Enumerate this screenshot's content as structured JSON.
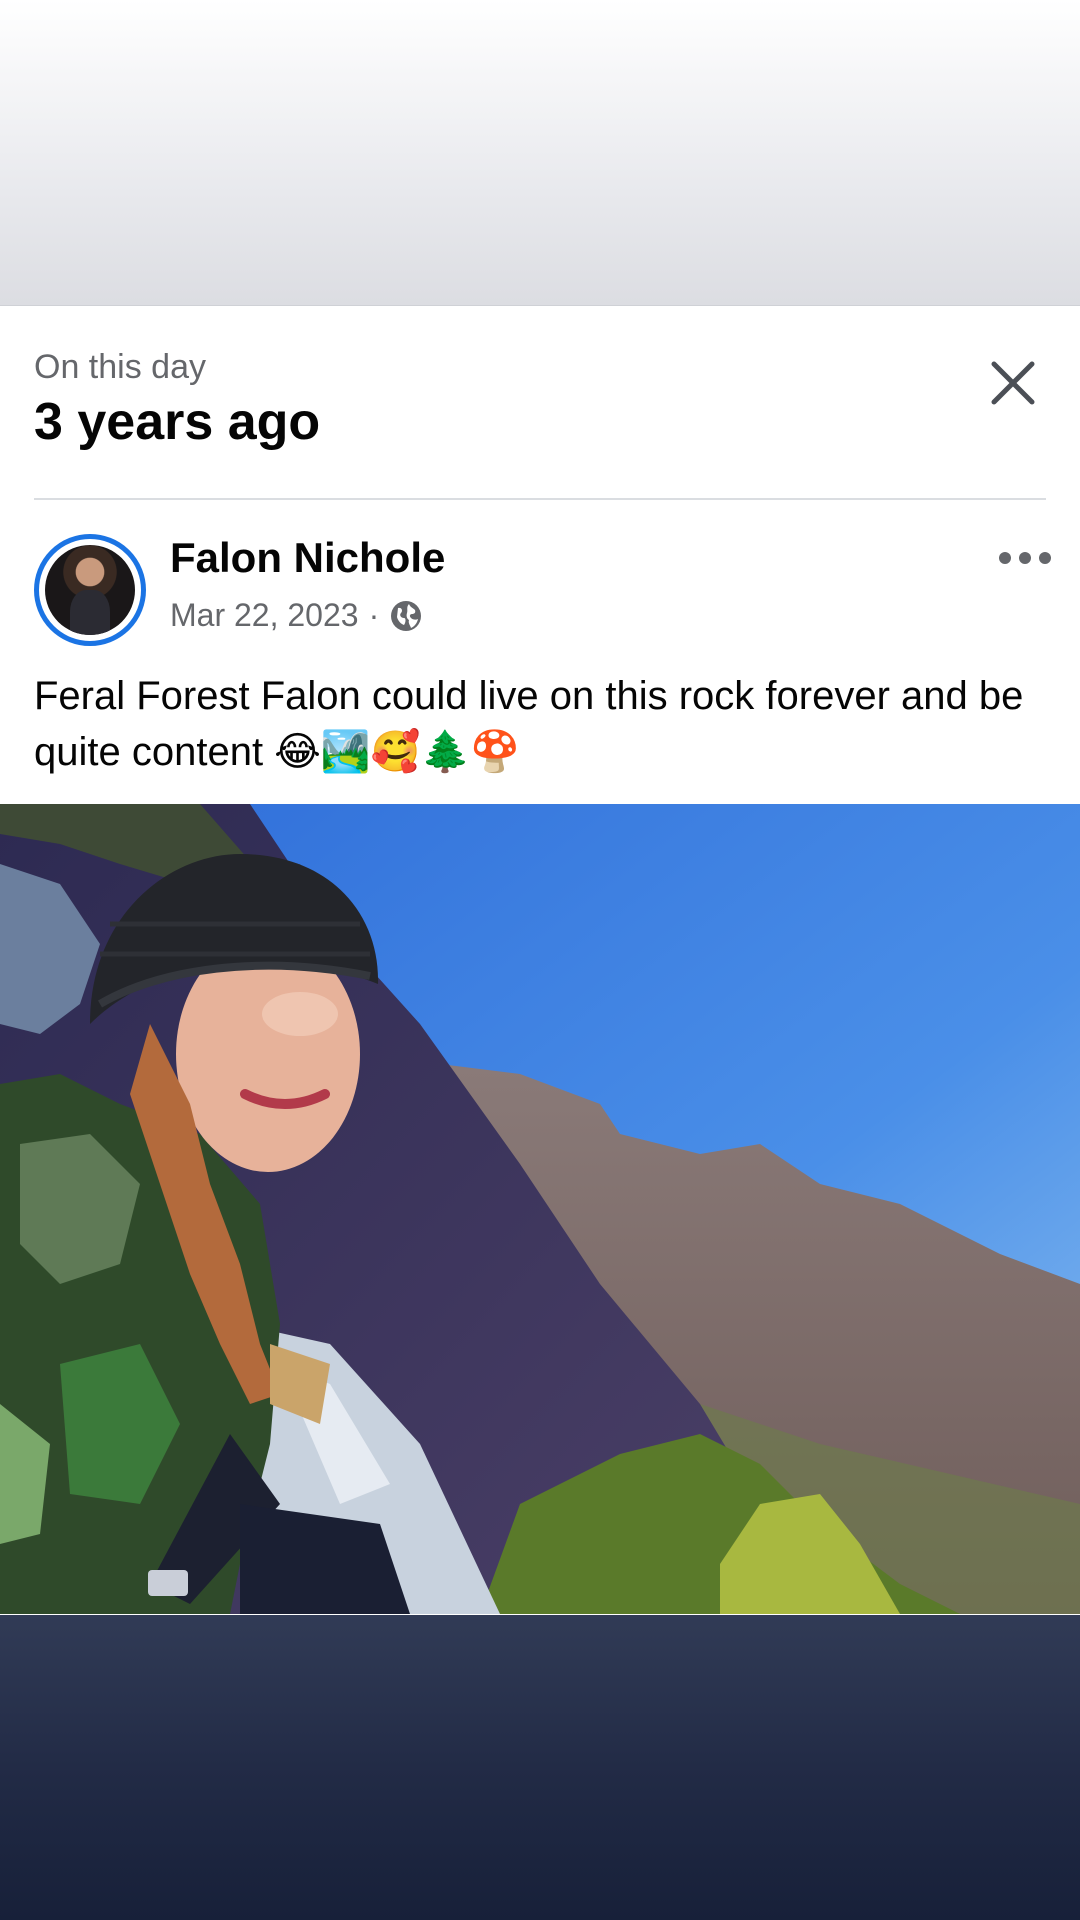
{
  "memory": {
    "eyebrow": "On this day",
    "title": "3 years ago"
  },
  "post": {
    "author": "Falon Nichole",
    "date": "Mar 22, 2023",
    "separator": "·",
    "audience_icon": "globe-icon",
    "text": "Feral Forest Falon could live on this rock forever and be quite content 😂🏞️🥰🌲🍄",
    "photo_alt": "Selfie of a woman in a black beanie and camo jacket on a rocky mountain ledge with a blue sky"
  },
  "icons": {
    "close": "close-icon",
    "more": "more-options-icon"
  },
  "colors": {
    "accent": "#1b74e4",
    "text_primary": "#050505",
    "text_secondary": "#65676b"
  }
}
